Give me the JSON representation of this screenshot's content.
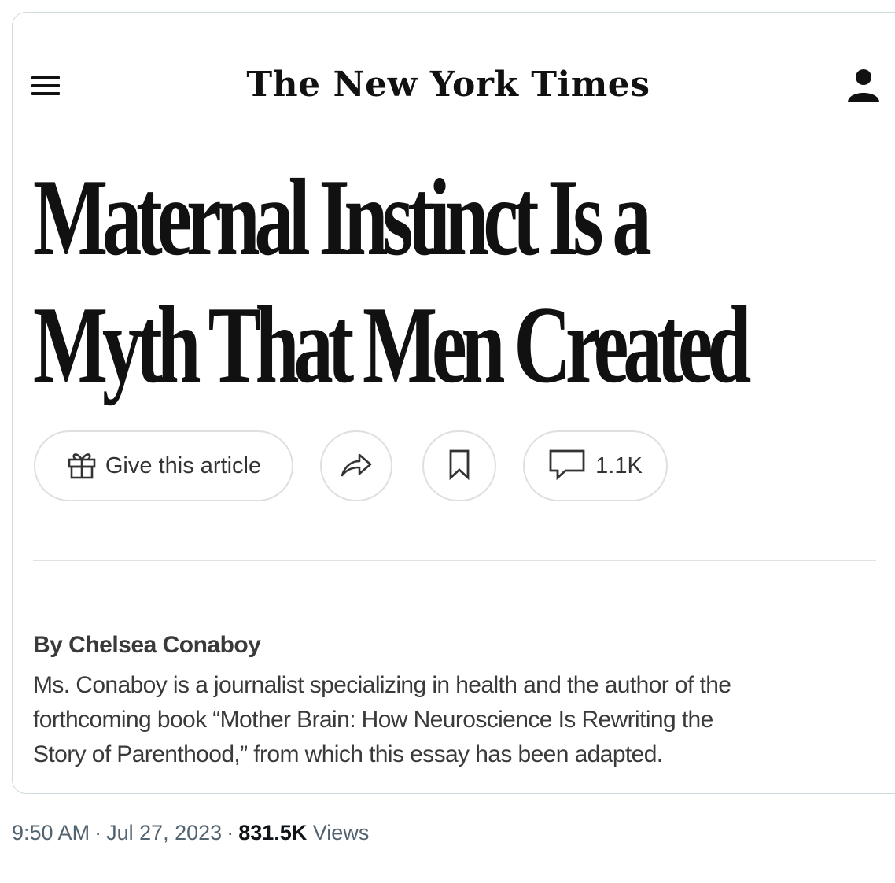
{
  "card": {
    "masthead": "The New York Times",
    "headline": {
      "line1": "Maternal Instinct Is a",
      "line2": "Myth That Men Created"
    },
    "actions": {
      "gift_label": "Give this article",
      "comments_count": "1.1K"
    },
    "byline": "By Chelsea Conaboy",
    "bio_lines": [
      "Ms. Conaboy is a journalist specializing in health and the author of the",
      "forthcoming book “Mother Brain: How Neuroscience Is Rewriting the",
      "Story of Parenthood,” from which this essay has been adapted."
    ]
  },
  "tweet_meta": {
    "time": "9:50 AM",
    "date": "Jul 27, 2023",
    "views_count": "831.5K",
    "views_label": "Views",
    "separator": "·"
  },
  "icons": {
    "menu": "hamburger-menu-icon",
    "account": "user-account-icon",
    "gift": "gift-icon",
    "share": "share-arrow-icon",
    "save": "bookmark-icon",
    "comment": "comment-bubble-icon"
  }
}
